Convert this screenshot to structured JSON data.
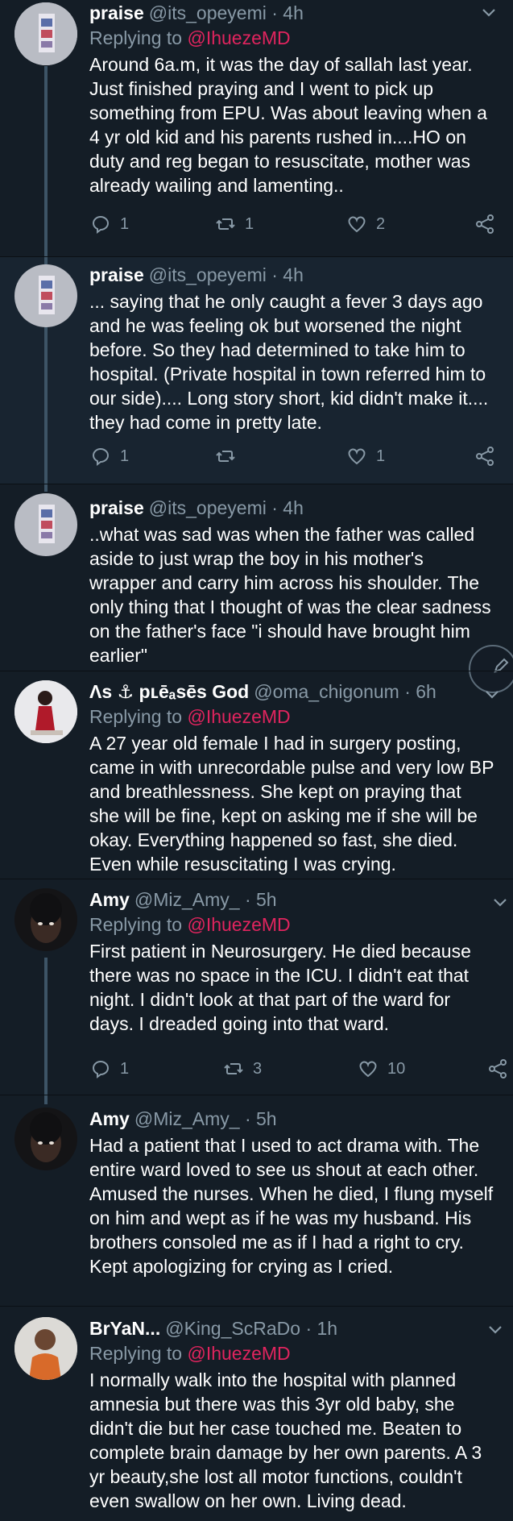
{
  "colors": {
    "background": "#141d26",
    "band": "#182430",
    "accent": "#e0245e",
    "muted": "#8899a6"
  },
  "tweets": [
    {
      "display_name": "praise",
      "handle": "@its_opeyemi",
      "time": "· 4h",
      "replying_label": "Replying to ",
      "replying_to": "@IhuezeMD",
      "text": "Around 6a.m, it was the day of sallah last year. Just finished praying and I went to pick up something from EPU. Was about leaving when a 4 yr old kid and his parents rushed in....HO on duty and reg began to resuscitate, mother was already wailing and lamenting..",
      "reply_count": "1",
      "retweet_count": "1",
      "like_count": "2"
    },
    {
      "display_name": "praise",
      "handle": "@its_opeyemi",
      "time": "· 4h",
      "text": "... saying that he only caught a fever 3 days ago and he was feeling ok but worsened the night before. So they had determined to take him to hospital. (Private hospital in town referred him to our side).... Long story short, kid didn't make it.... they had come in pretty late.",
      "reply_count": "1",
      "retweet_count": "",
      "like_count": "1"
    },
    {
      "display_name": "praise",
      "handle": "@its_opeyemi",
      "time": "· 4h",
      "text": "..what was sad was when the father was called aside to just wrap the boy in his mother's wrapper and carry him across his shoulder. The only thing that I thought of was the clear sadness on the father's face \"i should have brought him earlier\""
    },
    {
      "display_name": "Λs ⚓ pʟēₐsēs God",
      "handle": "@oma_chigonum",
      "time": "· 6h",
      "replying_label": "Replying to ",
      "replying_to": "@IhuezeMD",
      "text": "A 27 year old female I had in surgery posting, came in with unrecordable pulse and very low BP and breathlessness. She kept on praying that she will be fine, kept on asking me if she will be okay. Everything happened so fast, she died. Even while resuscitating I was crying."
    },
    {
      "display_name": "Amy",
      "handle": "@Miz_Amy_",
      "time": "· 5h",
      "replying_label": "Replying to ",
      "replying_to": "@IhuezeMD",
      "text": "First patient in Neurosurgery. He died because there was no space in the ICU. I didn't eat that night. I didn't look at that part of the ward for days. I dreaded going into that ward.",
      "reply_count": "1",
      "retweet_count": "3",
      "like_count": "10"
    },
    {
      "display_name": "Amy",
      "handle": "@Miz_Amy_",
      "time": "· 5h",
      "text": "Had a patient that I used to act drama with. The entire ward loved to see us shout at each other. Amused the nurses. When he died, I flung myself on him and wept as if he was my husband. His brothers consoled me as if I had a right to cry. Kept apologizing for crying as I cried."
    },
    {
      "display_name": "BrYaN...",
      "handle": "@King_ScRaDo",
      "time": "· 1h",
      "replying_label": "Replying to ",
      "replying_to": "@IhuezeMD",
      "text": "I normally walk into the hospital with planned amnesia but there was this 3yr old baby, she didn't die but her case touched me. Beaten to complete brain damage by her own parents. A 3 yr beauty,she lost all motor functions, couldn't even swallow on her own. Living dead."
    }
  ]
}
